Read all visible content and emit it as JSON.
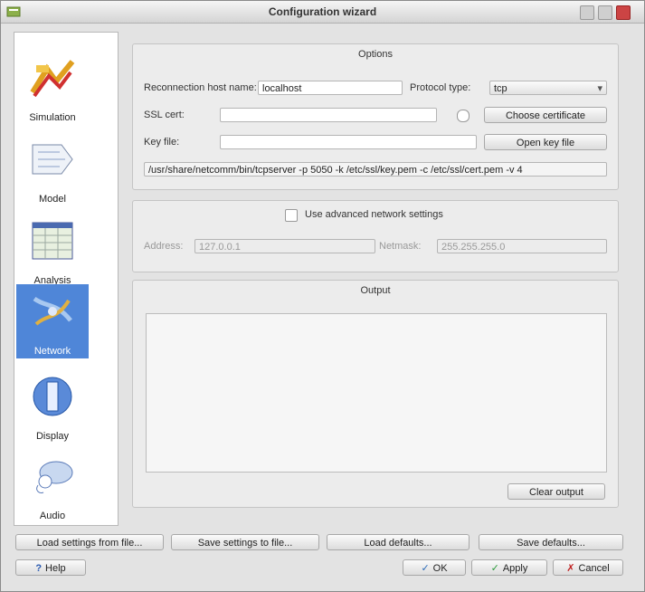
{
  "window": {
    "title": "Configuration wizard"
  },
  "sidebar": {
    "items": [
      {
        "label": "Simulation",
        "icon": "simulation-icon",
        "selected": false
      },
      {
        "label": "Model",
        "icon": "model-icon",
        "selected": false
      },
      {
        "label": "Analysis",
        "icon": "analysis-icon",
        "selected": false
      },
      {
        "label": "Network",
        "icon": "network-icon",
        "selected": true
      },
      {
        "label": "Display",
        "icon": "display-icon",
        "selected": false
      },
      {
        "label": "Audio",
        "icon": "audio-icon",
        "selected": false
      }
    ]
  },
  "options": {
    "title": "Options",
    "host_label": "Reconnection host name:",
    "host_value": "localhost",
    "protocol_label": "Protocol type:",
    "protocol_value": "tcp",
    "cert_label": "SSL cert:",
    "cert_value": "",
    "cert_button": "Choose certificate",
    "keyfile_label": "Key file:",
    "keyfile_value": "",
    "keyfile_button": "Open key file",
    "command_value": "/usr/share/netcomm/bin/tcpserver -p 5050 -k /etc/ssl/key.pem -c /etc/ssl/cert.pem -v 4"
  },
  "advanced": {
    "checkbox_label": "Use advanced network settings",
    "checked": false,
    "address_label": "Address:",
    "address_value": "127.0.0.1",
    "netmask_label": "Netmask:",
    "netmask_value": "255.255.255.0"
  },
  "output": {
    "title": "Output",
    "log_text": "",
    "clear_button": "Clear output"
  },
  "bottom_bar": {
    "btn1": "Load settings from file...",
    "btn2": "Save settings to file...",
    "btn3": "Load defaults...",
    "btn4": "Save defaults..."
  },
  "footer": {
    "help": "Help",
    "ok": "OK",
    "apply": "Apply",
    "cancel": "Cancel"
  },
  "colors": {
    "selection": "#4f86d8"
  }
}
